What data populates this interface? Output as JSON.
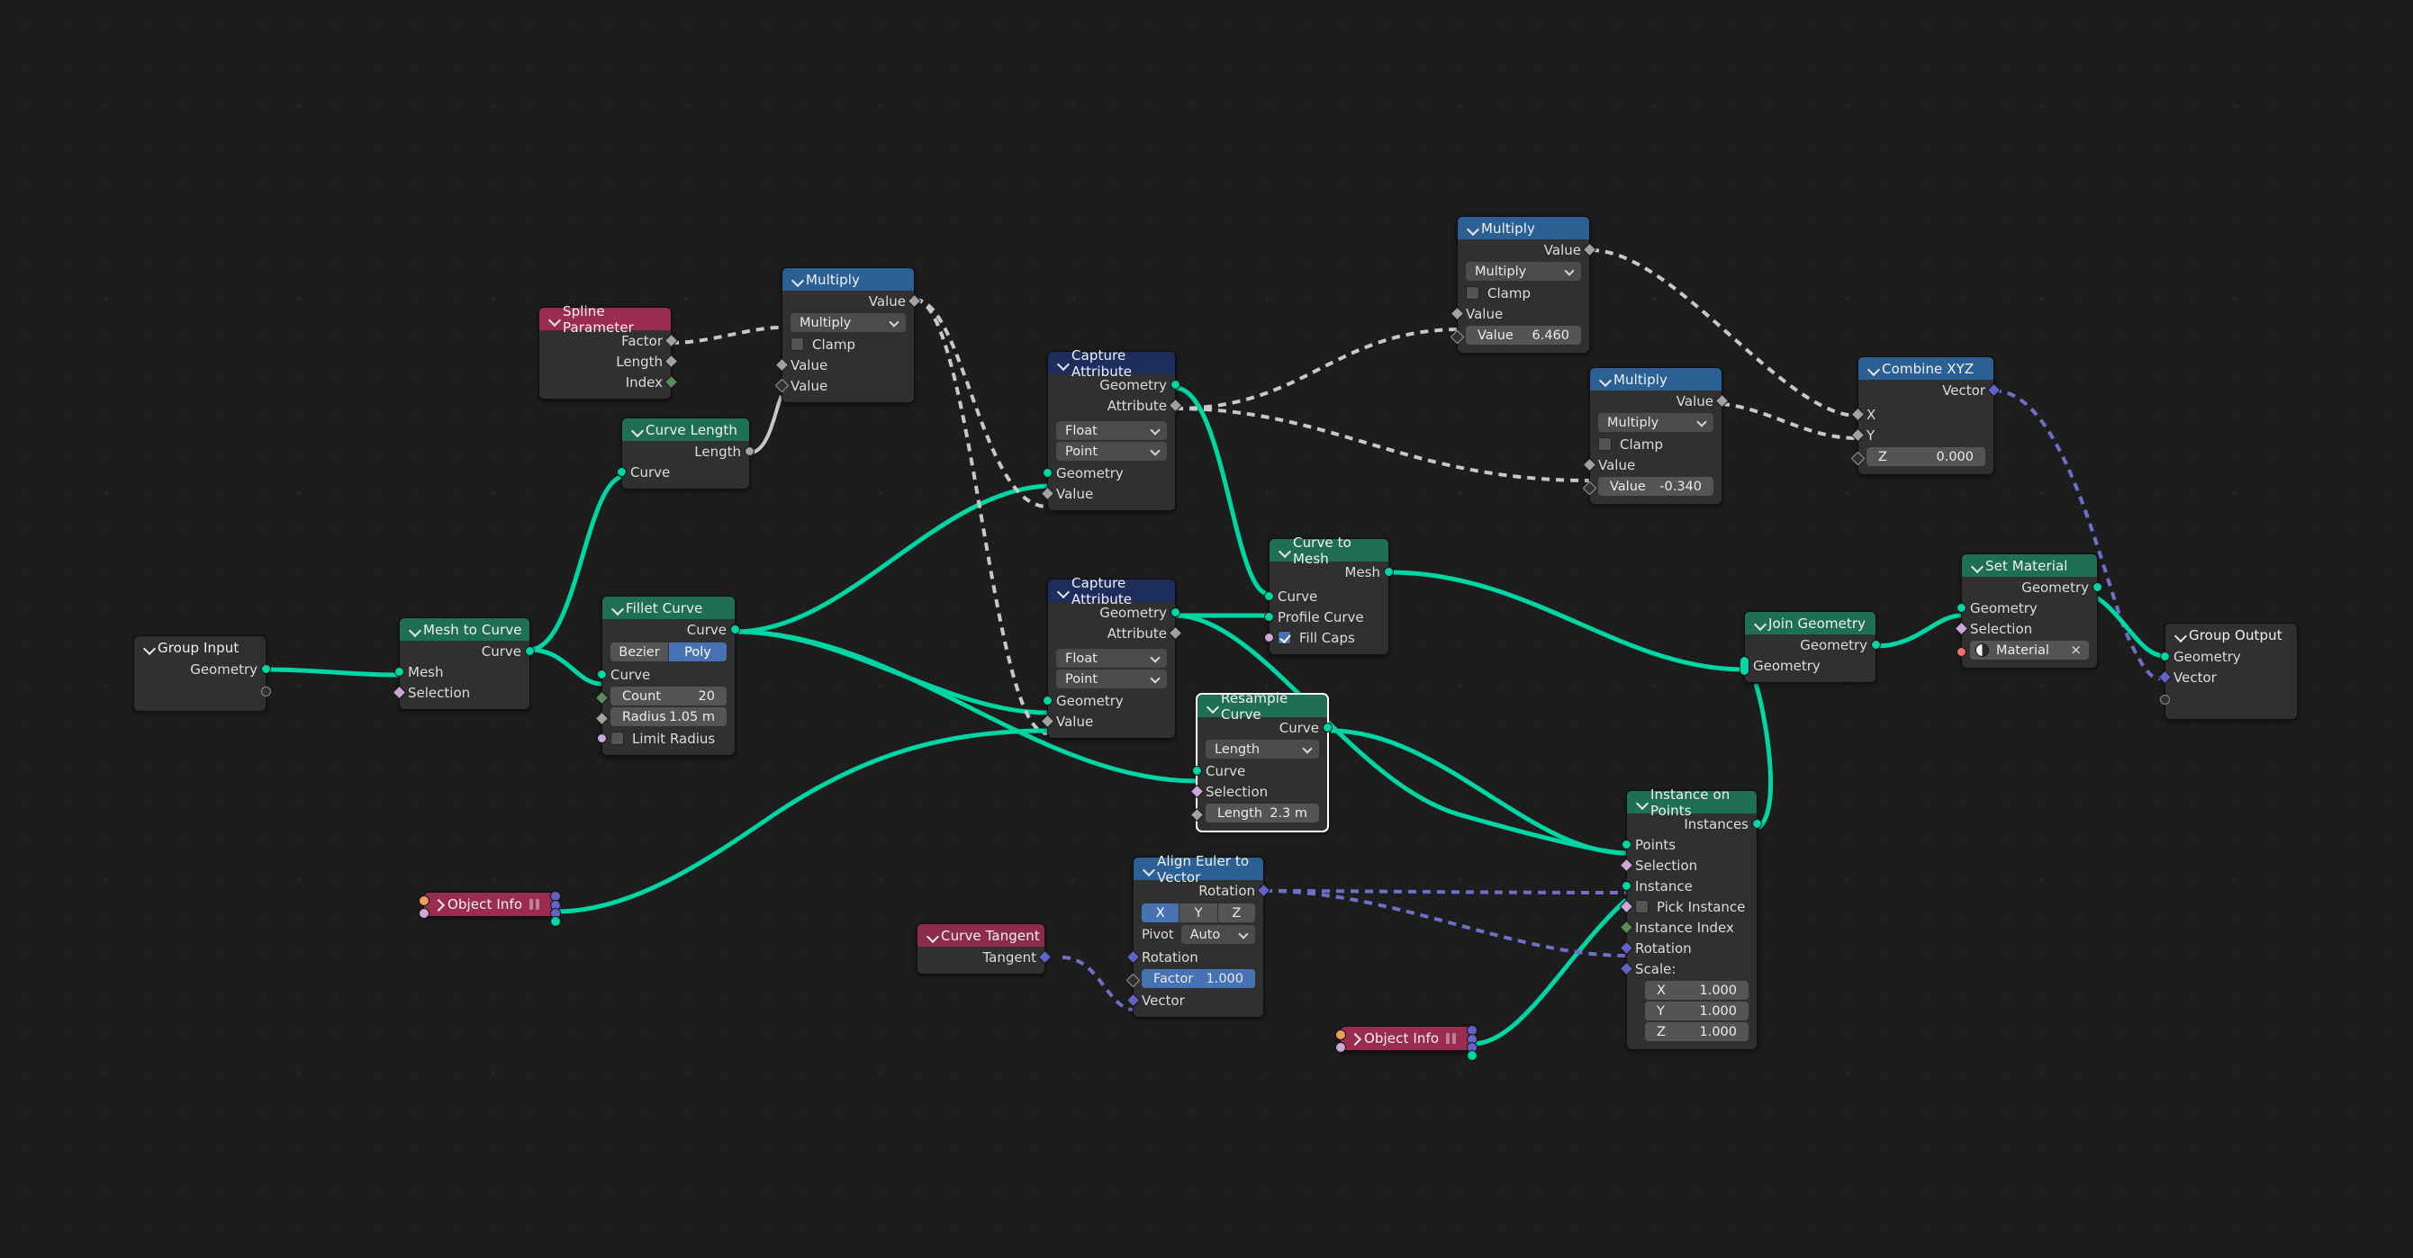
{
  "app": {
    "editor": "Geometry Node Editor",
    "background": "#1d1d1d"
  },
  "colors": {
    "geometry_header": "#1f6f55",
    "vector_header": "#2a6093",
    "attribute_header": "#1c2d5e",
    "input_header": "#9a2c4f",
    "accent_blue": "#4772b3",
    "geometry_socket": "#00d6a3",
    "float_socket": "#a1a1a1",
    "vector_socket": "#6363c7",
    "boolean_socket": "#cca6d6",
    "integer_socket": "#598c5c",
    "material_socket": "#eb7373",
    "object_socket": "#ed9e5c"
  },
  "nodes": {
    "group_input": {
      "title": "Group Input",
      "outputs": [
        "Geometry",
        ""
      ]
    },
    "mesh_to_curve": {
      "title": "Mesh to Curve",
      "outputs": [
        "Curve"
      ],
      "inputs": [
        "Mesh",
        "Selection"
      ]
    },
    "fillet_curve": {
      "title": "Fillet Curve",
      "outputs": [
        "Curve"
      ],
      "mode_options": [
        "Bezier",
        "Poly"
      ],
      "mode_selected": "Poly",
      "inputs": [
        "Curve"
      ],
      "fields": [
        {
          "label": "Count",
          "value": "20"
        },
        {
          "label": "Radius",
          "value": "1.05 m"
        }
      ],
      "limit_radius_label": "Limit Radius",
      "limit_radius_checked": false
    },
    "spline_parameter": {
      "title": "Spline Parameter",
      "outputs": [
        "Factor",
        "Length",
        "Index"
      ]
    },
    "curve_length": {
      "title": "Curve Length",
      "outputs": [
        "Length"
      ],
      "inputs": [
        "Curve"
      ]
    },
    "multiply_top": {
      "title": "Multiply",
      "outputs": [
        "Value"
      ],
      "operation": "Multiply",
      "clamp_label": "Clamp",
      "clamp_checked": false,
      "inputs": [
        "Value",
        "Value"
      ]
    },
    "multiply_mid": {
      "title": "Multiply",
      "outputs": [
        "Value"
      ],
      "operation": "Multiply",
      "clamp_label": "Clamp",
      "clamp_checked": false,
      "inputs": [
        "Value"
      ],
      "fields": [
        {
          "label": "Value",
          "value": "6.460"
        }
      ]
    },
    "multiply_low": {
      "title": "Multiply",
      "outputs": [
        "Value"
      ],
      "operation": "Multiply",
      "clamp_label": "Clamp",
      "clamp_checked": false,
      "inputs": [
        "Value"
      ],
      "fields": [
        {
          "label": "Value",
          "value": "-0.340"
        }
      ]
    },
    "capture_attribute_1": {
      "title": "Capture Attribute",
      "outputs": [
        "Geometry",
        "Attribute"
      ],
      "data_type": "Float",
      "domain": "Point",
      "inputs": [
        "Geometry",
        "Value"
      ]
    },
    "capture_attribute_2": {
      "title": "Capture Attribute",
      "outputs": [
        "Geometry",
        "Attribute"
      ],
      "data_type": "Float",
      "domain": "Point",
      "inputs": [
        "Geometry",
        "Value"
      ]
    },
    "curve_to_mesh": {
      "title": "Curve to Mesh",
      "outputs": [
        "Mesh"
      ],
      "inputs": [
        "Curve",
        "Profile Curve"
      ],
      "fill_caps_label": "Fill Caps",
      "fill_caps_checked": true
    },
    "combine_xyz": {
      "title": "Combine XYZ",
      "outputs": [
        "Vector"
      ],
      "inputs": [
        "X",
        "Y"
      ],
      "fields": [
        {
          "label": "Z",
          "value": "0.000"
        }
      ]
    },
    "set_material": {
      "title": "Set Material",
      "outputs": [
        "Geometry"
      ],
      "inputs": [
        "Geometry",
        "Selection"
      ],
      "material_name": "Material",
      "material_clear": "×"
    },
    "join_geometry": {
      "title": "Join Geometry",
      "outputs": [
        "Geometry"
      ],
      "inputs": [
        "Geometry"
      ]
    },
    "group_output": {
      "title": "Group Output",
      "inputs": [
        "Geometry",
        "Vector",
        ""
      ]
    },
    "resample_curve": {
      "title": "Resample Curve",
      "selected": true,
      "outputs": [
        "Curve"
      ],
      "mode": "Length",
      "inputs": [
        "Curve",
        "Selection"
      ],
      "fields": [
        {
          "label": "Length",
          "value": "2.3 m"
        }
      ]
    },
    "instance_on_points": {
      "title": "Instance on Points",
      "outputs": [
        "Instances"
      ],
      "inputs": [
        "Points",
        "Selection",
        "Instance"
      ],
      "pick_instance_label": "Pick Instance",
      "pick_instance_checked": false,
      "inputs2": [
        "Instance Index",
        "Rotation"
      ],
      "scale_label": "Scale:",
      "scale": [
        {
          "label": "X",
          "value": "1.000"
        },
        {
          "label": "Y",
          "value": "1.000"
        },
        {
          "label": "Z",
          "value": "1.000"
        }
      ]
    },
    "align_euler_to_vector": {
      "title": "Align Euler to Vector",
      "outputs": [
        "Rotation"
      ],
      "axis_options": [
        "X",
        "Y",
        "Z"
      ],
      "axis_selected": "X",
      "pivot_label": "Pivot",
      "pivot_value": "Auto",
      "inputs": [
        "Rotation"
      ],
      "factor": {
        "label": "Factor",
        "value": "1.000"
      },
      "inputs2": [
        "Vector"
      ]
    },
    "curve_tangent": {
      "title": "Curve Tangent",
      "outputs": [
        "Tangent"
      ]
    },
    "object_info_1": {
      "title": "Object Info",
      "collapsed": true
    },
    "object_info_2": {
      "title": "Object Info",
      "collapsed": true
    }
  }
}
